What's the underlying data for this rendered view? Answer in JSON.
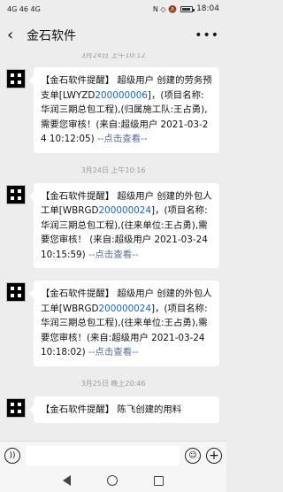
{
  "status_bar": {
    "signal_left": "4G 46 4G",
    "icons_right": "N ◇ 🔕",
    "battery_level": 0.7,
    "time": "18:04"
  },
  "header": {
    "title": "金石软件",
    "more_label": "•••"
  },
  "chat": {
    "top_time": "3月24日 上午10:12",
    "messages": [
      {
        "prefix": "【金石软件提醒】 超级用户 创建的劳务预支单[LWYZD",
        "code": "200000006",
        "suffix": "]，(项目名称:华润三期总包工程),(归属施工队:王占勇),需要您审核！(来自:超级用户 2021-03-24 10:12:05) ",
        "link": "--点击查看--"
      },
      {
        "time": "3月24日 上午10:16",
        "prefix": "【金石软件提醒】 超级用户 创建的外包人工单[WBRGD",
        "code": "200000024",
        "suffix": "]，(项目名称:华润三期总包工程),(往来单位:王占勇),需要您审核！ (来自:超级用户 2021-03-24 10:15:59) ",
        "link": "--点击查看--"
      },
      {
        "prefix": "【金石软件提醒】 超级用户 创建的外包人工单[WBRGD",
        "code": "200000024",
        "suffix": "]，(项目名称:华润三期总包工程),(往来单位:王占勇),需要您审核！(来自:超级用户 2021-03-24 10:18:02) ",
        "link": "--点击查看--"
      },
      {
        "time": "3月25日 晚上20:46",
        "text": "【金石软件提醒】 陈飞创建的用料"
      }
    ]
  },
  "input_bar": {
    "voice_icon": "voice-icon",
    "emoji_icon": "emoji-icon",
    "plus_label": "+"
  }
}
